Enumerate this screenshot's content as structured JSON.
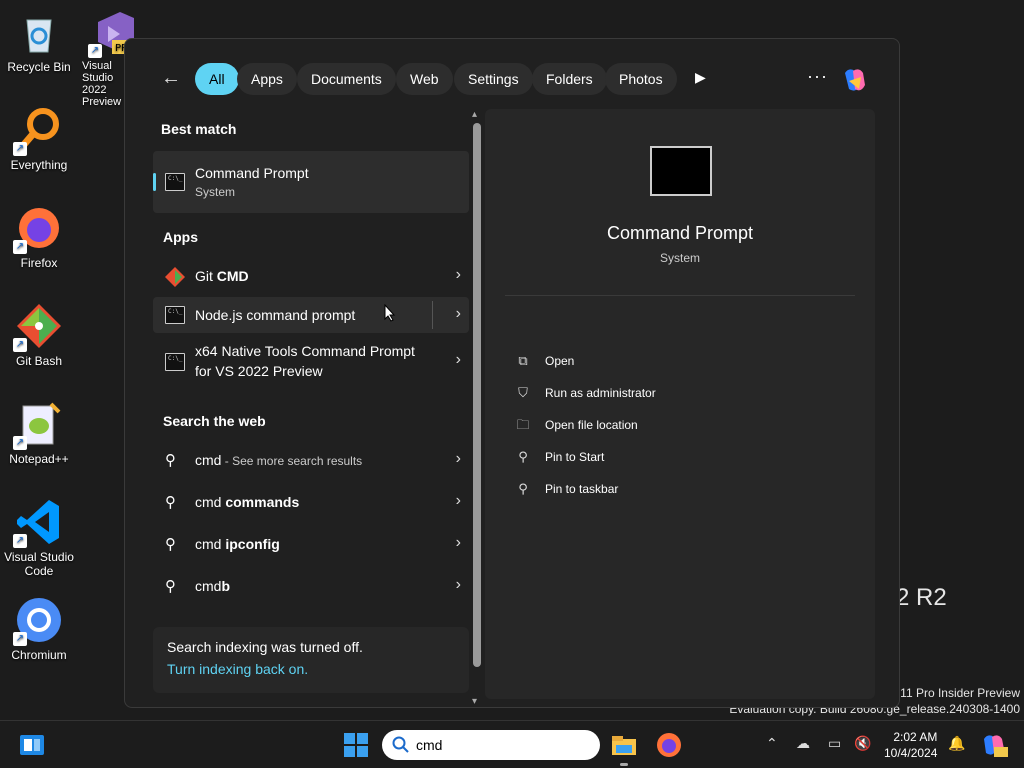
{
  "desktop": {
    "icons": [
      {
        "label": "Recycle Bin"
      },
      {
        "label": "Visual Studio 2022 Preview"
      },
      {
        "label": "Everything"
      },
      {
        "label": "Firefox"
      },
      {
        "label": "Git Bash"
      },
      {
        "label": "Notepad++"
      },
      {
        "label": "Visual Studio Code"
      },
      {
        "label": "Chromium"
      }
    ],
    "watermark_big": "2 R2",
    "watermark_line1": "11 Pro Insider Preview",
    "watermark_line2": "Evaluation copy. Build 26080.ge_release.240308-1400"
  },
  "search_panel": {
    "filters": [
      "All",
      "Apps",
      "Documents",
      "Web",
      "Settings",
      "Folders",
      "Photos"
    ],
    "active_filter": "All",
    "best_match_header": "Best match",
    "best_match": {
      "title": "Command Prompt",
      "subtitle": "System"
    },
    "apps_header": "Apps",
    "apps": [
      {
        "label": "Git ",
        "bold": "CMD"
      },
      {
        "label": "Node.js command prompt"
      },
      {
        "label": "x64 Native Tools Command Prompt for VS 2022 Preview"
      }
    ],
    "web_header": "Search the web",
    "web": [
      {
        "prefix": "cmd",
        "suffix": " - See more search results"
      },
      {
        "prefix": "cmd ",
        "bold": "commands"
      },
      {
        "prefix": "cmd ",
        "bold": "ipconfig"
      },
      {
        "prefix": "cmd",
        "bold": "b"
      }
    ],
    "notice": {
      "text": "Search indexing was turned off.",
      "link": "Turn indexing back on."
    },
    "preview": {
      "title": "Command Prompt",
      "subtitle": "System",
      "actions": [
        "Open",
        "Run as administrator",
        "Open file location",
        "Pin to Start",
        "Pin to taskbar"
      ]
    }
  },
  "taskbar": {
    "search_value": "cmd",
    "time": "2:02 AM",
    "date": "10/4/2024"
  },
  "colors": {
    "accent": "#5fd3f3",
    "background": "#202020"
  }
}
